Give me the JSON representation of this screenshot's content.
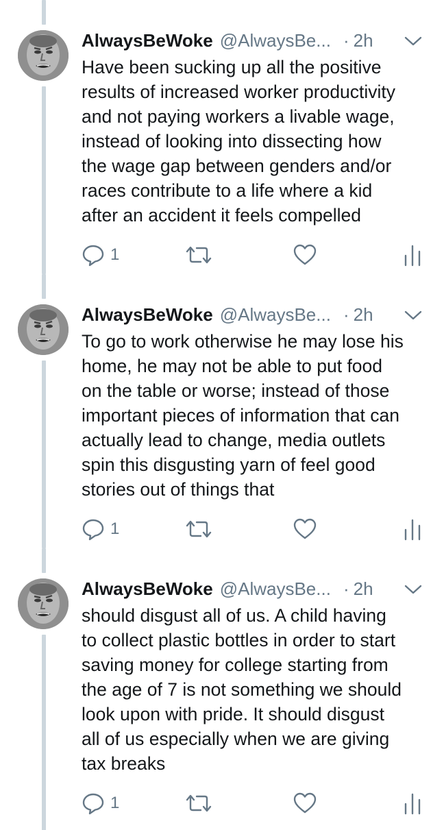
{
  "colors": {
    "text": "#14171a",
    "secondary": "#657786",
    "thread_line": "#ccd6dd",
    "background": "#ffffff"
  },
  "icons": {
    "reply": "reply-icon",
    "retweet": "retweet-icon",
    "like": "heart-icon",
    "analytics": "analytics-icon",
    "menu": "chevron-down-icon"
  },
  "tweets": [
    {
      "name": "AlwaysBeWoke",
      "handle": "@AlwaysBe...",
      "separator": "·",
      "time": "2h",
      "lines": [
        "Have been sucking up all the positive",
        "results of increased worker productivity",
        "and not paying workers a livable wage,",
        "instead of looking into dissecting how",
        "the wage gap between genders and/or",
        "races contribute to a life where a kid",
        "after an accident it feels compelled"
      ],
      "reply_count": "1"
    },
    {
      "name": "AlwaysBeWoke",
      "handle": "@AlwaysBe...",
      "separator": "·",
      "time": "2h",
      "lines": [
        "To go to work otherwise he may lose his",
        "home, he may not be able to put food",
        "on the table or worse; instead of those",
        "important pieces of information that can",
        "actually lead to change, media outlets",
        "spin this disgusting yarn of feel good",
        "stories out of things that"
      ],
      "reply_count": "1"
    },
    {
      "name": "AlwaysBeWoke",
      "handle": "@AlwaysBe...",
      "separator": "·",
      "time": "2h",
      "lines": [
        "should disgust all of us. A child having",
        "to collect plastic bottles in order to start",
        "saving money for college starting from",
        "the age of 7 is not something we should",
        "look upon  with pride. It should disgust",
        "all of us especially when we are giving",
        "tax breaks"
      ],
      "reply_count": "1"
    }
  ]
}
